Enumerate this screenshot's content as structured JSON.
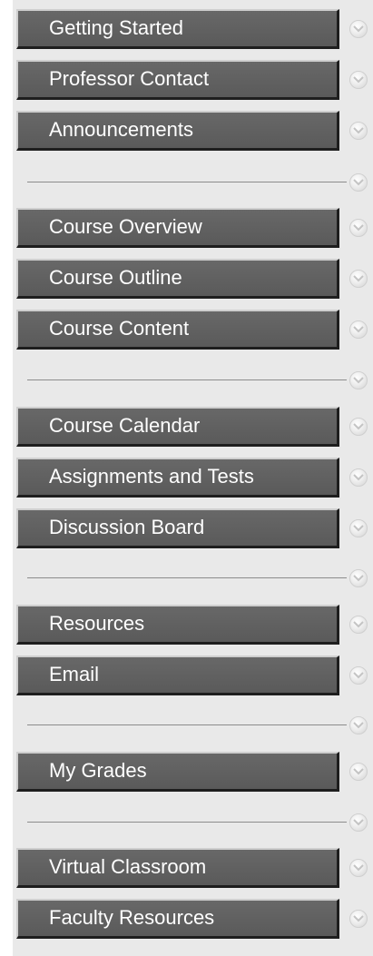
{
  "menu": {
    "items": [
      {
        "label": "Getting Started"
      },
      {
        "label": "Professor Contact"
      },
      {
        "label": "Announcements"
      },
      {
        "label": "Course Overview"
      },
      {
        "label": "Course Outline"
      },
      {
        "label": "Course Content"
      },
      {
        "label": "Course Calendar"
      },
      {
        "label": "Assignments and Tests"
      },
      {
        "label": "Discussion Board"
      },
      {
        "label": "Resources"
      },
      {
        "label": "Email"
      },
      {
        "label": "My Grades"
      },
      {
        "label": "Virtual Classroom"
      },
      {
        "label": "Faculty Resources"
      }
    ]
  },
  "colors": {
    "button_bg": "#5f5f5f",
    "button_text": "#ffffff",
    "panel_bg": "#e9e9e9",
    "separator": "#8c8c8c"
  },
  "icons": {
    "expand": "chevron-down-icon"
  }
}
